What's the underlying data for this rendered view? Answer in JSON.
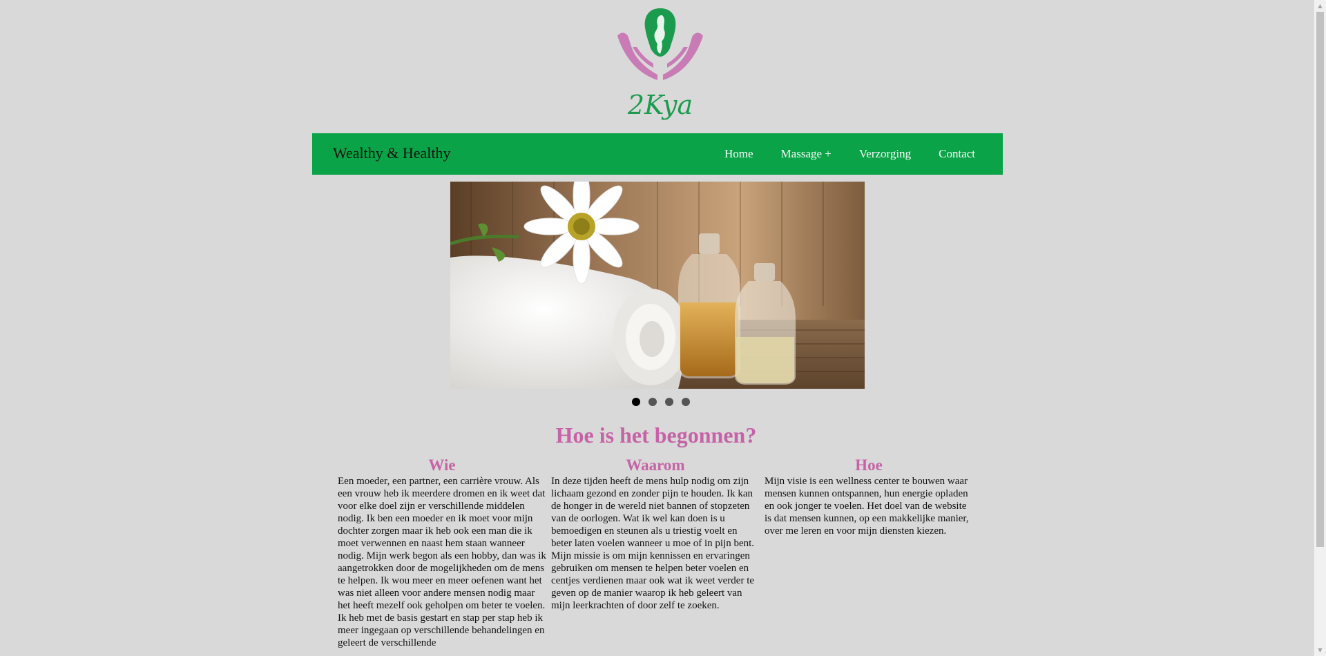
{
  "logo": {
    "text": "2Kya",
    "colors": {
      "green": "#1b9b4e",
      "pink": "#c97bb5"
    }
  },
  "navbar": {
    "brand": "Wealthy & Healthy",
    "background": "#0aa347",
    "links": [
      {
        "label": "Home"
      },
      {
        "label": "Massage +"
      },
      {
        "label": "Verzorging"
      },
      {
        "label": "Contact"
      }
    ]
  },
  "carousel": {
    "slide_count": 4,
    "active_index": 0
  },
  "intro": {
    "title": "Hoe is het begonnen?",
    "columns": [
      {
        "heading": "Wie",
        "text": "Een moeder, een partner, een carrière vrouw. Als een vrouw heb ik meerdere dromen en ik weet dat voor elke doel zijn er verschillende middelen nodig. Ik ben een moeder en ik moet voor mijn dochter zorgen maar ik heb ook een man die ik moet verwennen en naast hem staan wanneer nodig. Mijn werk begon als een hobby, dan was ik aangetrokken door de mogelijkheden om de mens te helpen. Ik wou meer en meer oefenen want het was niet alleen voor andere mensen nodig maar het heeft mezelf ook geholpen om beter te voelen. Ik heb met de basis gestart en stap per stap heb ik meer ingegaan op verschillende behandelingen en geleert de verschillende"
      },
      {
        "heading": "Waarom",
        "text": "In deze tijden heeft de mens hulp nodig om zijn lichaam gezond en zonder pijn te houden. Ik kan de honger in de wereld niet bannen of stopzeten van de oorlogen. Wat ik wel kan doen is u bemoedigen en steunen als u triestig voelt en beter laten voelen wanneer u moe of in pijn bent. Mijn missie is om mijn kennissen en ervaringen gebruiken om mensen te helpen beter voelen en centjes verdienen maar ook wat ik weet verder te geven op de manier waarop ik heb geleert van mijn leerkrachten of door zelf te zoeken."
      },
      {
        "heading": "Hoe",
        "text": "Mijn visie is een wellness center te bouwen waar mensen kunnen ontspannen, hun energie opladen en ook jonger te voelen. Het doel van de website is dat mensen kunnen, op een makkelijke manier, over me leren en voor mijn diensten kiezen."
      }
    ]
  },
  "colors": {
    "page_background": "#d9d9d9",
    "heading_pink": "#c663a6"
  }
}
